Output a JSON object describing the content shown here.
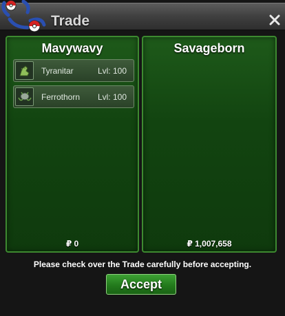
{
  "window": {
    "title": "Trade",
    "close_icon": "close-icon",
    "logo_icon": "pokeball-logo-icon"
  },
  "left_panel": {
    "trainer_name": "Mavywavy",
    "pokemon": [
      {
        "name": "Tyranitar",
        "level": "Lvl: 100",
        "icon": "tyranitar-sprite-icon"
      },
      {
        "name": "Ferrothorn",
        "level": "Lvl: 100",
        "icon": "ferrothorn-sprite-icon"
      }
    ],
    "money": "₽ 0"
  },
  "right_panel": {
    "trainer_name": "Savageborn",
    "pokemon": [],
    "money": "₽ 1,007,658"
  },
  "footer": {
    "notice": "Please check over the Trade carefully before accepting.",
    "accept_label": "Accept"
  },
  "colors": {
    "panel_green": "#124410",
    "panel_border": "#3d8a30",
    "accept_green": "#237a1c",
    "titlebar": "#3f3f3f"
  }
}
